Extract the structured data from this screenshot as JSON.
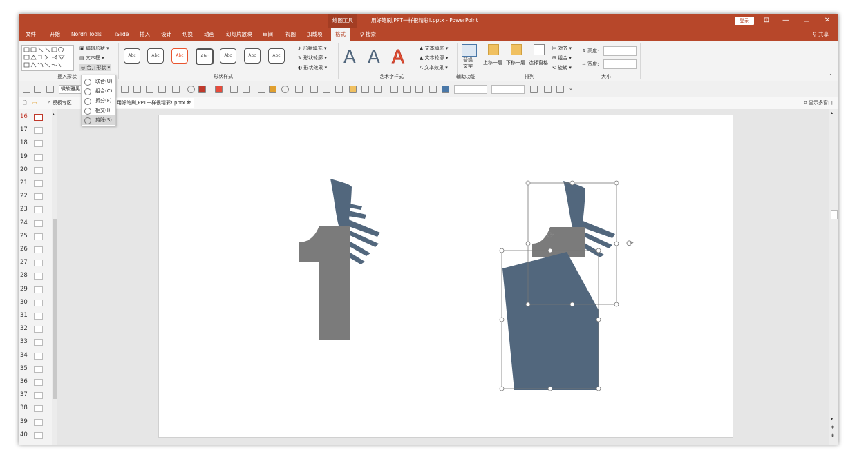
{
  "window": {
    "context_tab": "绘图工具",
    "document_title": "用好笔刷,PPT一样很精彩!.pptx - PowerPoint",
    "login_label": "登录",
    "share_label": "共享",
    "controls": {
      "ribbon_opts": "⊡",
      "minimize": "—",
      "restore": "❐",
      "close": "✕"
    }
  },
  "menubar": [
    "文件",
    "开始",
    "Nordri Tools",
    "iSlide",
    "插入",
    "设计",
    "切换",
    "动画",
    "幻灯片放映",
    "审阅",
    "视图",
    "加载项",
    "格式"
  ],
  "menubar_active": "格式",
  "search_label": "搜索",
  "ribbon": {
    "insert_shape": {
      "label": "插入形状",
      "edit_shape": "编辑形状",
      "text_box": "文本框",
      "merge_shapes": "合并形状"
    },
    "shape_styles": {
      "label": "形状样式",
      "sample": "Abc",
      "fill": "形状填充",
      "outline": "形状轮廓",
      "effects": "形状效果"
    },
    "wordart": {
      "label": "艺术字样式",
      "sample": "A",
      "text_fill": "文本填充",
      "text_outline": "文本轮廓",
      "text_effects": "文本效果"
    },
    "accessibility": {
      "label": "辅助功能",
      "alt_text_1": "替换",
      "alt_text_2": "文字"
    },
    "arrange": {
      "label": "排列",
      "bring_forward": "上移一层",
      "send_backward": "下移一层",
      "selection_pane": "选择窗格",
      "align": "对齐",
      "group": "组合",
      "rotate": "旋转"
    },
    "size": {
      "label": "大小",
      "height": "高度:",
      "width": "宽度:"
    }
  },
  "merge_menu": [
    {
      "label": "联合(U)",
      "selected": false
    },
    {
      "label": "组合(C)",
      "selected": false
    },
    {
      "label": "拆分(F)",
      "selected": false
    },
    {
      "label": "相交(I)",
      "selected": false
    },
    {
      "label": "剪除(S)",
      "selected": true
    }
  ],
  "toolbar2": {
    "font_name": "微软雅黑"
  },
  "tabs": {
    "template_zone": "模板专区",
    "doc_tab": "用好笔刷,PPT一样很精彩!.pptx",
    "show_multi": "显示多窗口"
  },
  "thumbnails": [
    "16",
    "17",
    "18",
    "19",
    "20",
    "21",
    "22",
    "23",
    "24",
    "25",
    "26",
    "27",
    "28",
    "29",
    "30",
    "31",
    "32",
    "33",
    "34",
    "35",
    "36",
    "37",
    "38",
    "39",
    "40"
  ],
  "current_slide": "16",
  "colors": {
    "accent": "#b7472a",
    "shape_blue": "#52677d",
    "shape_gray": "#7b7b7b",
    "wordart_red": "#e8542f"
  },
  "icons": {
    "rotate": "⟳"
  }
}
